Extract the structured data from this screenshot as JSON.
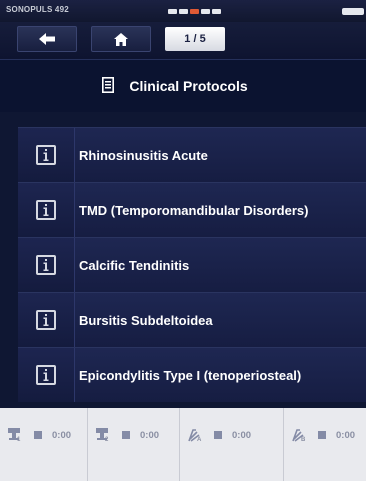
{
  "status_bar": {
    "device_name": "SONOPULS 492"
  },
  "nav": {
    "back_icon": "arrow-left-icon",
    "home_icon": "home-icon",
    "page_counter": "1 / 5"
  },
  "header": {
    "icon": "document-icon",
    "title": "Clinical Protocols"
  },
  "protocols": [
    {
      "label": "Rhinosinusitis Acute",
      "icon": "info-icon"
    },
    {
      "label": "TMD (Temporomandibular Disorders)",
      "icon": "info-icon"
    },
    {
      "label": "Calcific Tendinitis",
      "icon": "info-icon"
    },
    {
      "label": "Bursitis Subdeltoidea",
      "icon": "info-icon"
    },
    {
      "label": "Epicondylitis Type I (tenoperiosteal)",
      "icon": "info-icon"
    }
  ],
  "channels": [
    {
      "icon": "ultrasound-probe-1-icon",
      "icon_label": "1",
      "time": "0:00"
    },
    {
      "icon": "ultrasound-probe-2-icon",
      "icon_label": "2",
      "time": "0:00"
    },
    {
      "icon": "electrode-a-icon",
      "icon_label": "A",
      "time": "0:00"
    },
    {
      "icon": "electrode-b-icon",
      "icon_label": "B",
      "time": "0:00"
    }
  ],
  "colors": {
    "background": "#0f1733",
    "list_item": "#1e2752",
    "accent": "#e05a35",
    "channel_bar": "#e9eaee"
  }
}
